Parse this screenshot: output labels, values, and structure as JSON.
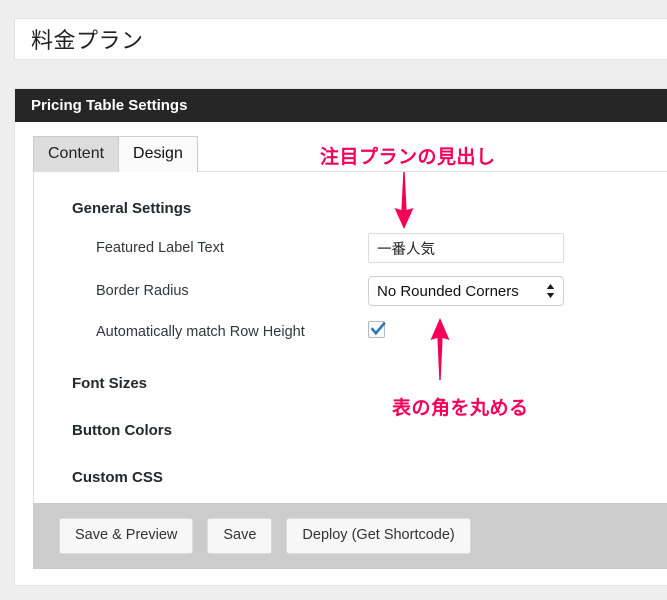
{
  "page": {
    "title": "料金プラン",
    "background_color": "#eeeeee"
  },
  "panel": {
    "header_title": "Pricing Table Settings",
    "header_bg": "#262626"
  },
  "tabs": [
    {
      "label": "Content",
      "active": false
    },
    {
      "label": "Design",
      "active": true
    }
  ],
  "sections": {
    "general": "General Settings",
    "font_sizes": "Font Sizes",
    "button_colors": "Button Colors",
    "custom_css": "Custom CSS"
  },
  "fields": {
    "featured_label": {
      "label": "Featured Label Text",
      "value": "一番人気",
      "placeholder": ""
    },
    "border_radius": {
      "label": "Border Radius",
      "value": "No Rounded Corners",
      "options": [
        "No Rounded Corners"
      ]
    },
    "auto_row_height": {
      "label": "Automatically match Row Height",
      "checked": true,
      "check_color": "#2a7ab0"
    }
  },
  "footer": {
    "save_preview_label": "Save & Preview",
    "save_label": "Save",
    "deploy_label": "Deploy (Get Shortcode)",
    "bg": "#cccccc"
  },
  "annotations": {
    "color": "#f50057",
    "top_text": "注目プランの見出し",
    "bottom_text": "表の角を丸める"
  }
}
